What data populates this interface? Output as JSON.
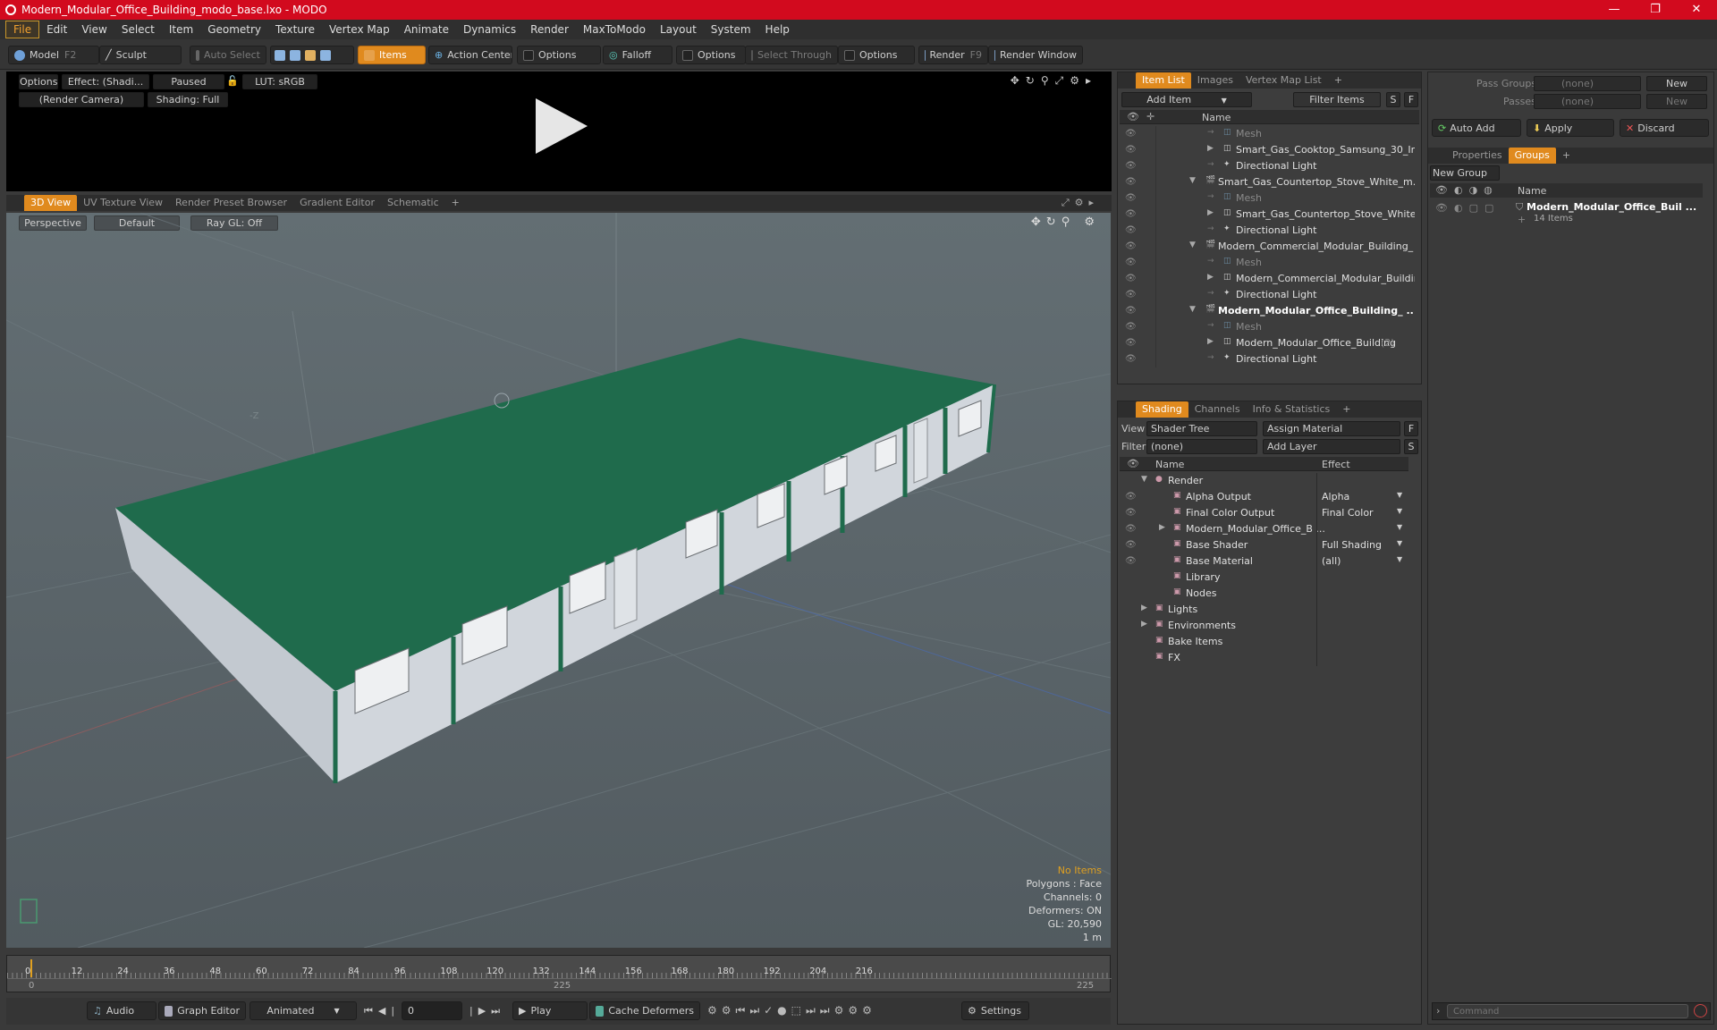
{
  "window": {
    "title": "Modern_Modular_Office_Building_modo_base.lxo - MODO",
    "minimize": "—",
    "maximize": "❐",
    "close": "✕"
  },
  "menu": [
    "File",
    "Edit",
    "View",
    "Select",
    "Item",
    "Geometry",
    "Texture",
    "Vertex Map",
    "Animate",
    "Dynamics",
    "Render",
    "MaxToModo",
    "Layout",
    "System",
    "Help"
  ],
  "toolbar": {
    "model": "Model",
    "model_key": "F2",
    "sculpt": "Sculpt",
    "auto_select": "Auto Select",
    "items": "Items",
    "action_center": "Action Center",
    "options1": "Options",
    "falloff": "Falloff",
    "options2": "Options",
    "select_through": "Select Through",
    "options3": "Options",
    "render": "Render",
    "render_key": "F9",
    "render_window": "Render Window"
  },
  "preview": {
    "options": "Options",
    "effect": "Effect: (Shadi...",
    "paused": "Paused",
    "lut": "LUT: sRGB",
    "camera": "(Render Camera)",
    "shading": "Shading: Full"
  },
  "view_tabs": [
    "3D View",
    "UV Texture View",
    "Render Preset Browser",
    "Gradient Editor",
    "Schematic",
    "+"
  ],
  "viewport": {
    "perspective": "Perspective",
    "default": "Default",
    "raygl": "Ray GL: Off",
    "axis_label": "-Z",
    "status": {
      "no_items": "No Items",
      "polygons": "Polygons : Face",
      "channels": "Channels: 0",
      "deformers": "Deformers: ON",
      "gl": "GL: 20,590",
      "scale": "1 m"
    }
  },
  "timeline": {
    "ticks": [
      "0",
      "12",
      "24",
      "36",
      "48",
      "60",
      "72",
      "84",
      "96",
      "108",
      "120",
      "132",
      "144",
      "156",
      "168",
      "180",
      "192",
      "204",
      "216"
    ],
    "range_start": "0",
    "range_mid": "225",
    "range_end": "225"
  },
  "bottom": {
    "audio": "Audio",
    "graph_editor": "Graph Editor",
    "animated": "Animated",
    "frame": "0",
    "play": "Play",
    "cache": "Cache Deformers",
    "settings": "Settings"
  },
  "item_list": {
    "tabs": [
      "Item List",
      "Images",
      "Vertex Map List",
      "+"
    ],
    "add_item": "Add Item",
    "filter": "Filter Items",
    "s": "S",
    "f": "F",
    "name_header": "Name",
    "rows": [
      {
        "text": "Mesh",
        "dim": true,
        "indent": 2
      },
      {
        "text": "Smart_Gas_Cooktop_Samsung_30_In ...",
        "indent": 2,
        "tri": "▶"
      },
      {
        "text": "Directional Light",
        "indent": 2
      },
      {
        "text": "Smart_Gas_Countertop_Stove_White_m...",
        "indent": 1,
        "tri": "▼"
      },
      {
        "text": "Mesh",
        "dim": true,
        "indent": 2
      },
      {
        "text": "Smart_Gas_Countertop_Stove_White ...",
        "indent": 2,
        "tri": "▶"
      },
      {
        "text": "Directional Light",
        "indent": 2
      },
      {
        "text": "Modern_Commercial_Modular_Building_ ...",
        "indent": 1,
        "tri": "▼"
      },
      {
        "text": "Mesh",
        "dim": true,
        "indent": 2
      },
      {
        "text": "Modern_Commercial_Modular_Building...",
        "indent": 2,
        "tri": "▶"
      },
      {
        "text": "Directional Light",
        "indent": 2
      },
      {
        "text": "Modern_Modular_Office_Building_ ...",
        "indent": 1,
        "tri": "▼",
        "bold": true
      },
      {
        "text": "Mesh",
        "dim": true,
        "indent": 2
      },
      {
        "text": "Modern_Modular_Office_Building",
        "indent": 2,
        "tri": "▶",
        "count": "(2)"
      },
      {
        "text": "Directional Light",
        "indent": 2
      }
    ]
  },
  "shading": {
    "tabs": [
      "Shading",
      "Channels",
      "Info & Statistics",
      "+"
    ],
    "view_label": "View",
    "view_value": "Shader Tree",
    "assign": "Assign Material",
    "f": "F",
    "filter_label": "Filter",
    "filter_value": "(none)",
    "add_layer": "Add Layer",
    "s": "S",
    "name_header": "Name",
    "effect_header": "Effect",
    "rows": [
      {
        "name": "Render",
        "effect": "",
        "eye": false,
        "indent": 0,
        "tri": "▼"
      },
      {
        "name": "Alpha Output",
        "effect": "Alpha",
        "eye": true,
        "indent": 1
      },
      {
        "name": "Final Color Output",
        "effect": "Final Color",
        "eye": true,
        "indent": 1
      },
      {
        "name": "Modern_Modular_Office_B ...",
        "effect": "",
        "eye": true,
        "indent": 1,
        "tri": "▶"
      },
      {
        "name": "Base Shader",
        "effect": "Full Shading",
        "eye": true,
        "indent": 1
      },
      {
        "name": "Base Material",
        "effect": "(all)",
        "eye": true,
        "indent": 1
      },
      {
        "name": "Library",
        "effect": "",
        "eye": false,
        "indent": 1
      },
      {
        "name": "Nodes",
        "effect": "",
        "eye": false,
        "indent": 1
      },
      {
        "name": "Lights",
        "effect": "",
        "eye": false,
        "indent": 0,
        "tri": "▶"
      },
      {
        "name": "Environments",
        "effect": "",
        "eye": false,
        "indent": 0,
        "tri": "▶"
      },
      {
        "name": "Bake Items",
        "effect": "",
        "eye": false,
        "indent": 0
      },
      {
        "name": "FX",
        "effect": "",
        "eye": false,
        "indent": 0
      }
    ]
  },
  "groups": {
    "pass_groups_label": "Pass Groups",
    "pass_groups_value": "(none)",
    "new": "New",
    "passes_label": "Passes",
    "passes_value": "(none)",
    "new2": "New",
    "auto_add": "Auto Add",
    "apply": "Apply",
    "discard": "Discard",
    "tabs": [
      "Properties",
      "Groups",
      "+"
    ],
    "new_group": "New Group",
    "name_header": "Name",
    "item_name": "Modern_Modular_Office_Buil ...",
    "item_count": "14 Items"
  },
  "command": {
    "placeholder": "Command"
  }
}
